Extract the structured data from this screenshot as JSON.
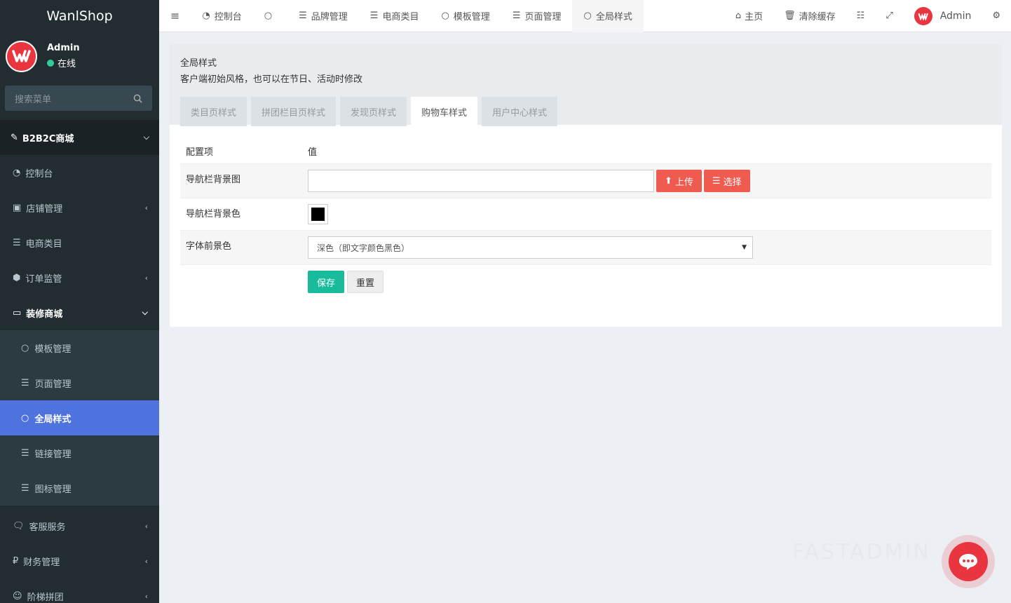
{
  "brand": "WanlShop",
  "user": {
    "name": "Admin",
    "status": "在线"
  },
  "search": {
    "placeholder": "搜索菜单"
  },
  "sidebar": {
    "header": "B2B2C商城",
    "items": [
      {
        "label": "控制台",
        "icon": "dashboard-icon"
      },
      {
        "label": "店铺管理",
        "icon": "store-icon"
      },
      {
        "label": "电商类目",
        "icon": "list-ol-icon"
      },
      {
        "label": "订单监管",
        "icon": "cube-icon"
      },
      {
        "label": "装修商城",
        "icon": "desktop-icon"
      }
    ],
    "sub_items": [
      {
        "label": "模板管理",
        "icon": "circle-icon"
      },
      {
        "label": "页面管理",
        "icon": "list-icon"
      },
      {
        "label": "全局样式",
        "icon": "circle-icon",
        "active": true
      },
      {
        "label": "链接管理",
        "icon": "list-icon"
      },
      {
        "label": "图标管理",
        "icon": "list-icon"
      }
    ],
    "bottom_items": [
      {
        "label": "客服服务",
        "icon": "comments-icon"
      },
      {
        "label": "财务管理",
        "icon": "rouble-icon"
      },
      {
        "label": "阶梯拼团",
        "icon": "users-icon"
      }
    ]
  },
  "topnav": {
    "tabs": [
      {
        "label": "控制台",
        "icon": "dashboard-icon"
      },
      {
        "label": "",
        "icon": "circle-icon"
      },
      {
        "label": "品牌管理",
        "icon": "list-icon"
      },
      {
        "label": "电商类目",
        "icon": "list-ol-icon"
      },
      {
        "label": "模板管理",
        "icon": "circle-icon"
      },
      {
        "label": "页面管理",
        "icon": "list-icon"
      },
      {
        "label": "全局样式",
        "icon": "circle-icon"
      }
    ],
    "home": "主页",
    "clear_cache": "清除缓存",
    "admin": "Admin"
  },
  "panel": {
    "title": "全局样式",
    "description": "客户端初始风格，也可以在节日、活动时修改",
    "tabs": [
      "类目页样式",
      "拼团栏目页样式",
      "发现页样式",
      "购物车样式",
      "用户中心样式"
    ],
    "active_tab": "购物车样式"
  },
  "form": {
    "col_config": "配置项",
    "col_value": "值",
    "nav_bg_image_label": "导航栏背景图",
    "nav_bg_image_value": "",
    "upload_label": "上传",
    "choose_label": "选择",
    "nav_bg_color_label": "导航栏背景色",
    "nav_bg_color_value": "#000000",
    "font_color_label": "字体前景色",
    "font_color_value": "深色（即文字颜色黑色）",
    "save_label": "保存",
    "reset_label": "重置"
  },
  "watermark": "FASTADMIN",
  "colors": {
    "accent": "#4e73df",
    "danger": "#f05b4f",
    "success": "#18bc9c",
    "sidebar": "#222d32"
  }
}
